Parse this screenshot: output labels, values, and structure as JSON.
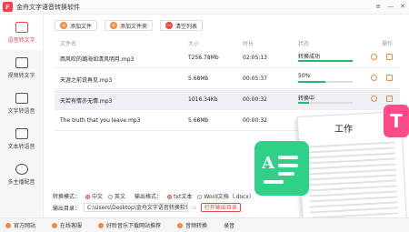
{
  "app": {
    "title": "金舟文字语音转换软件",
    "logo_char": "F"
  },
  "sidebar": {
    "items": [
      {
        "label": "语音转文字",
        "active": true
      },
      {
        "label": "视频转文字"
      },
      {
        "label": "文字转语音"
      },
      {
        "label": "文本转语音"
      },
      {
        "label": "多主播配音"
      }
    ]
  },
  "toolbar": {
    "add_file": "添加文件",
    "add_folder": "添加文件夹",
    "clear_list": "清空列表"
  },
  "table": {
    "headers": {
      "name": "文件名",
      "size": "大小",
      "duration": "时长",
      "status": "状态",
      "ops": "操作"
    },
    "rows": [
      {
        "name": "西风吹的瀚海如清风明月.mp3",
        "size": "T256.78Mb",
        "duration": "02:05:13",
        "status": "转换成功",
        "progress": 1.0
      },
      {
        "name": "天涯之前说再见.mp3",
        "size": "5.68Mb",
        "duration": "00:05:37",
        "status": "50%",
        "progress": 0.5
      },
      {
        "name": "天若有情亦无情.mp3",
        "size": "1016.34Kb",
        "duration": "00:00:32",
        "status": "转换中",
        "progress": 0.2
      },
      {
        "name": "The truth that you leave.mp3",
        "size": "5.68Mb",
        "duration": "00:00:32",
        "status": "",
        "progress": null
      }
    ]
  },
  "options": {
    "mode_label": "转换模式：",
    "mode_cn": "中文",
    "mode_en": "英文",
    "format_label": "输出格式：",
    "format_txt": "txt文本",
    "format_word": "Word文档（.docx）",
    "output_label": "输出目录：",
    "output_path": "C:\\Users\\Desktop\\金舟文字语音转换软件",
    "open_folder": "打开输出目录"
  },
  "footer": {
    "items": [
      "官方网站",
      "在线客服",
      "好聆音乐下载网站推荐",
      "音频转换",
      "录音"
    ]
  },
  "promo": {
    "title": "工作",
    "green_letter": "A",
    "pink_letter": "T"
  },
  "colors": {
    "brand": "#ef4545",
    "accent": "#f08a3c",
    "success": "#2bb673",
    "promo_green": "#2fd087",
    "promo_pink": "#ff4b87"
  }
}
